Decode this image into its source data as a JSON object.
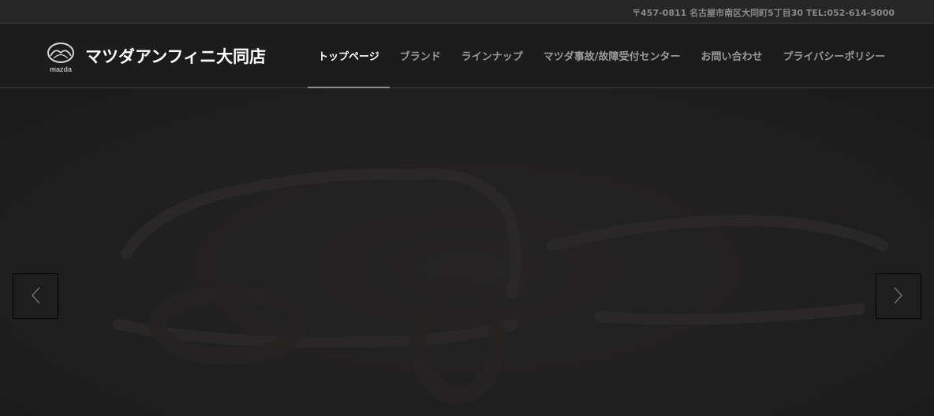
{
  "topbar": {
    "address": "〒457-0811 名古屋市南区大同町5丁目30 TEL:052-614-5000"
  },
  "header": {
    "logo_text": "mazda",
    "brand_name": "マツダアンフィニ大同店"
  },
  "nav": {
    "items": [
      {
        "label": "トップページ",
        "active": true
      },
      {
        "label": "ブランド",
        "active": false
      },
      {
        "label": "ラインナップ",
        "active": false
      },
      {
        "label": "マツダ事故/故障受付センター",
        "active": false
      },
      {
        "label": "お問い合わせ",
        "active": false
      },
      {
        "label": "プライバシーポリシー",
        "active": false
      }
    ]
  },
  "slider": {
    "prev_icon": "chevron-left-icon",
    "next_icon": "chevron-right-icon"
  },
  "colors": {
    "background": "#1f1e1e",
    "header": "#1c1c1c",
    "active_nav": "#ffffff",
    "inactive_nav": "#9a9a9a"
  }
}
